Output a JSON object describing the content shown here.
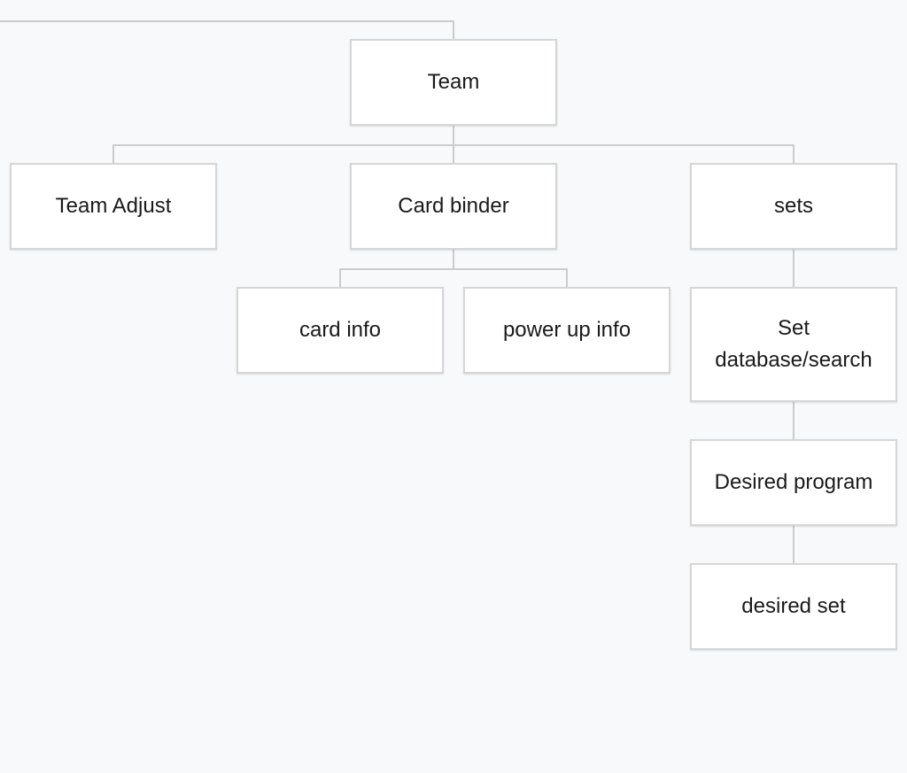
{
  "diagram": {
    "nodes": {
      "team": "Team",
      "team_adjust": "Team Adjust",
      "card_binder": "Card binder",
      "sets": "sets",
      "card_info": "card info",
      "power_up_info": "power up info",
      "set_database": "Set database/search",
      "desired_program": "Desired program",
      "desired_set": "desired set"
    },
    "edges": [
      [
        "(off-screen parent)",
        "Team"
      ],
      [
        "Team",
        "Team Adjust"
      ],
      [
        "Team",
        "Card binder"
      ],
      [
        "Team",
        "sets"
      ],
      [
        "Card binder",
        "card info"
      ],
      [
        "Card binder",
        "power up info"
      ],
      [
        "sets",
        "Set database/search"
      ],
      [
        "Set database/search",
        "Desired program"
      ],
      [
        "Desired program",
        "desired set"
      ]
    ]
  }
}
